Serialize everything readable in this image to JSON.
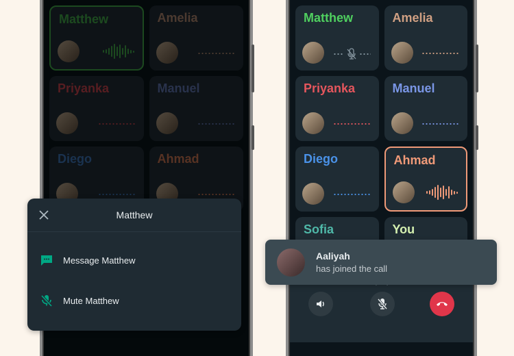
{
  "left_phone": {
    "participants": [
      {
        "name": "Matthew",
        "color": "#3fa246",
        "state": "speaking"
      },
      {
        "name": "Amelia",
        "color": "#a8826a",
        "state": "idle"
      },
      {
        "name": "Priyanka",
        "color": "#c0424a",
        "state": "idle"
      },
      {
        "name": "Manuel",
        "color": "#5b70a8",
        "state": "idle"
      },
      {
        "name": "Diego",
        "color": "#3a6fb0",
        "state": "idle"
      },
      {
        "name": "Ahmad",
        "color": "#c0704e",
        "state": "idle"
      }
    ],
    "sheet": {
      "title": "Matthew",
      "close_icon": "close-icon",
      "items": [
        {
          "label": "Message Matthew",
          "icon": "message-icon"
        },
        {
          "label": "Mute Matthew",
          "icon": "mic-off-icon"
        }
      ],
      "accent": "#00a884"
    }
  },
  "right_phone": {
    "participants": [
      {
        "name": "Matthew",
        "color": "#4fcf5f",
        "state": "muted"
      },
      {
        "name": "Amelia",
        "color": "#d0a083",
        "state": "idle"
      },
      {
        "name": "Priyanka",
        "color": "#e5565d",
        "state": "idle"
      },
      {
        "name": "Manuel",
        "color": "#7a96e6",
        "state": "idle"
      },
      {
        "name": "Diego",
        "color": "#4a92e8",
        "state": "idle"
      },
      {
        "name": "Ahmad",
        "color": "#f09a78",
        "state": "speaking"
      },
      {
        "name": "Sofia",
        "color": "#4fb8a8",
        "state": "idle"
      },
      {
        "name": "You",
        "color": "#d4f0b0",
        "state": "idle"
      }
    ],
    "toast": {
      "name": "Aaliyah",
      "message": "has joined the call"
    },
    "controls": {
      "speaker": "speaker-icon",
      "mute": "mic-off-icon",
      "end": "end-call-icon",
      "end_color": "#e0364a"
    }
  }
}
